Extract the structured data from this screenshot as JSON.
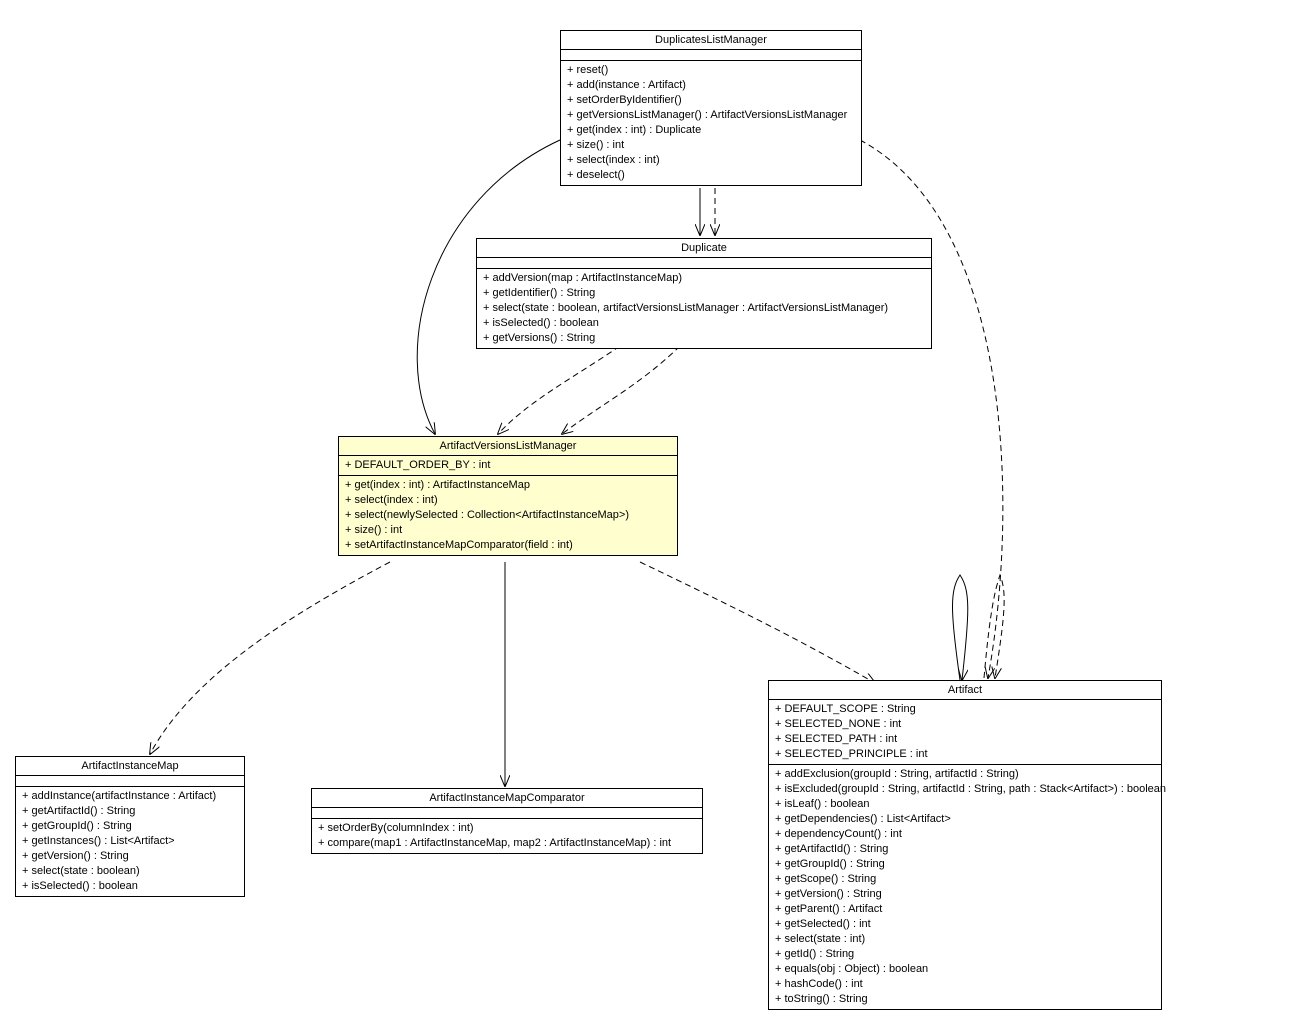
{
  "classes": {
    "duplicatesListManager": {
      "name": "DuplicatesListManager",
      "attributes": [],
      "methods": [
        "+ reset()",
        "+ add(instance : Artifact)",
        "+ setOrderByIdentifier()",
        "+ getVersionsListManager() : ArtifactVersionsListManager",
        "+ get(index : int) : Duplicate",
        "+ size() : int",
        "+ select(index : int)",
        "+ deselect()"
      ]
    },
    "duplicate": {
      "name": "Duplicate",
      "attributes": [],
      "methods": [
        "+ addVersion(map : ArtifactInstanceMap)",
        "+ getIdentifier() : String",
        "+ select(state : boolean, artifactVersionsListManager : ArtifactVersionsListManager)",
        "+ isSelected() : boolean",
        "+ getVersions() : String"
      ]
    },
    "artifactVersionsListManager": {
      "name": "ArtifactVersionsListManager",
      "attributes": [
        "+ DEFAULT_ORDER_BY : int"
      ],
      "methods": [
        "+ get(index : int) : ArtifactInstanceMap",
        "+ select(index : int)",
        "+ select(newlySelected : Collection<ArtifactInstanceMap>)",
        "+ size() : int",
        "+ setArtifactInstanceMapComparator(field : int)"
      ]
    },
    "artifactInstanceMap": {
      "name": "ArtifactInstanceMap",
      "attributes": [],
      "methods": [
        "+ addInstance(artifactInstance : Artifact)",
        "+ getArtifactId() : String",
        "+ getGroupId() : String",
        "+ getInstances() : List<Artifact>",
        "+ getVersion() : String",
        "+ select(state : boolean)",
        "+ isSelected() : boolean"
      ]
    },
    "artifactInstanceMapComparator": {
      "name": "ArtifactInstanceMapComparator",
      "attributes": [],
      "methods": [
        "+ setOrderBy(columnIndex : int)",
        "+ compare(map1 : ArtifactInstanceMap, map2 : ArtifactInstanceMap) : int"
      ]
    },
    "artifact": {
      "name": "Artifact",
      "attributes": [
        "+ DEFAULT_SCOPE : String",
        "+ SELECTED_NONE : int",
        "+ SELECTED_PATH : int",
        "+ SELECTED_PRINCIPLE : int"
      ],
      "methods": [
        "+ addExclusion(groupId : String, artifactId : String)",
        "+ isExcluded(groupId : String, artifactId : String, path : Stack<Artifact>) : boolean",
        "+ isLeaf() : boolean",
        "+ getDependencies() : List<Artifact>",
        "+ dependencyCount() : int",
        "+ getArtifactId() : String",
        "+ getGroupId() : String",
        "+ getScope() : String",
        "+ getVersion() : String",
        "+ getParent() : Artifact",
        "+ getSelected() : int",
        "+ select(state : int)",
        "+ getId() : String",
        "+ equals(obj : Object) : boolean",
        "+ hashCode() : int",
        "+ toString() : String"
      ]
    }
  }
}
